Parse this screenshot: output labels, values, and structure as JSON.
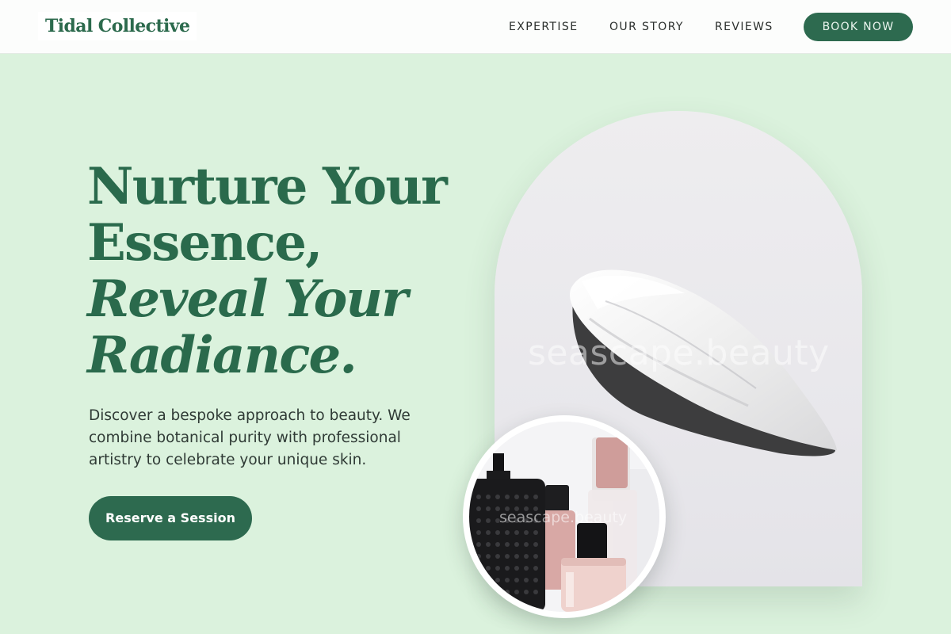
{
  "header": {
    "brand": "Tidal Collective",
    "nav": [
      "EXPERTISE",
      "OUR STORY",
      "REVIEWS"
    ],
    "cta": "BOOK NOW"
  },
  "hero": {
    "headline_line1": "Nurture Your",
    "headline_line2": "Essence,",
    "headline_line3": "Reveal Your",
    "headline_line4": "Radiance.",
    "intro": "Discover a bespoke approach to beauty. We combine botanical purity with professional artistry to celebrate your unique skin.",
    "cta": "Reserve a Session"
  },
  "images": {
    "main_watermark": "seascape.beauty",
    "inset_watermark": "seascape.beauty"
  },
  "colors": {
    "brand_green": "#2d6a4f",
    "hero_background": "#dbf2dd",
    "header_background": "#fcfdfc"
  }
}
